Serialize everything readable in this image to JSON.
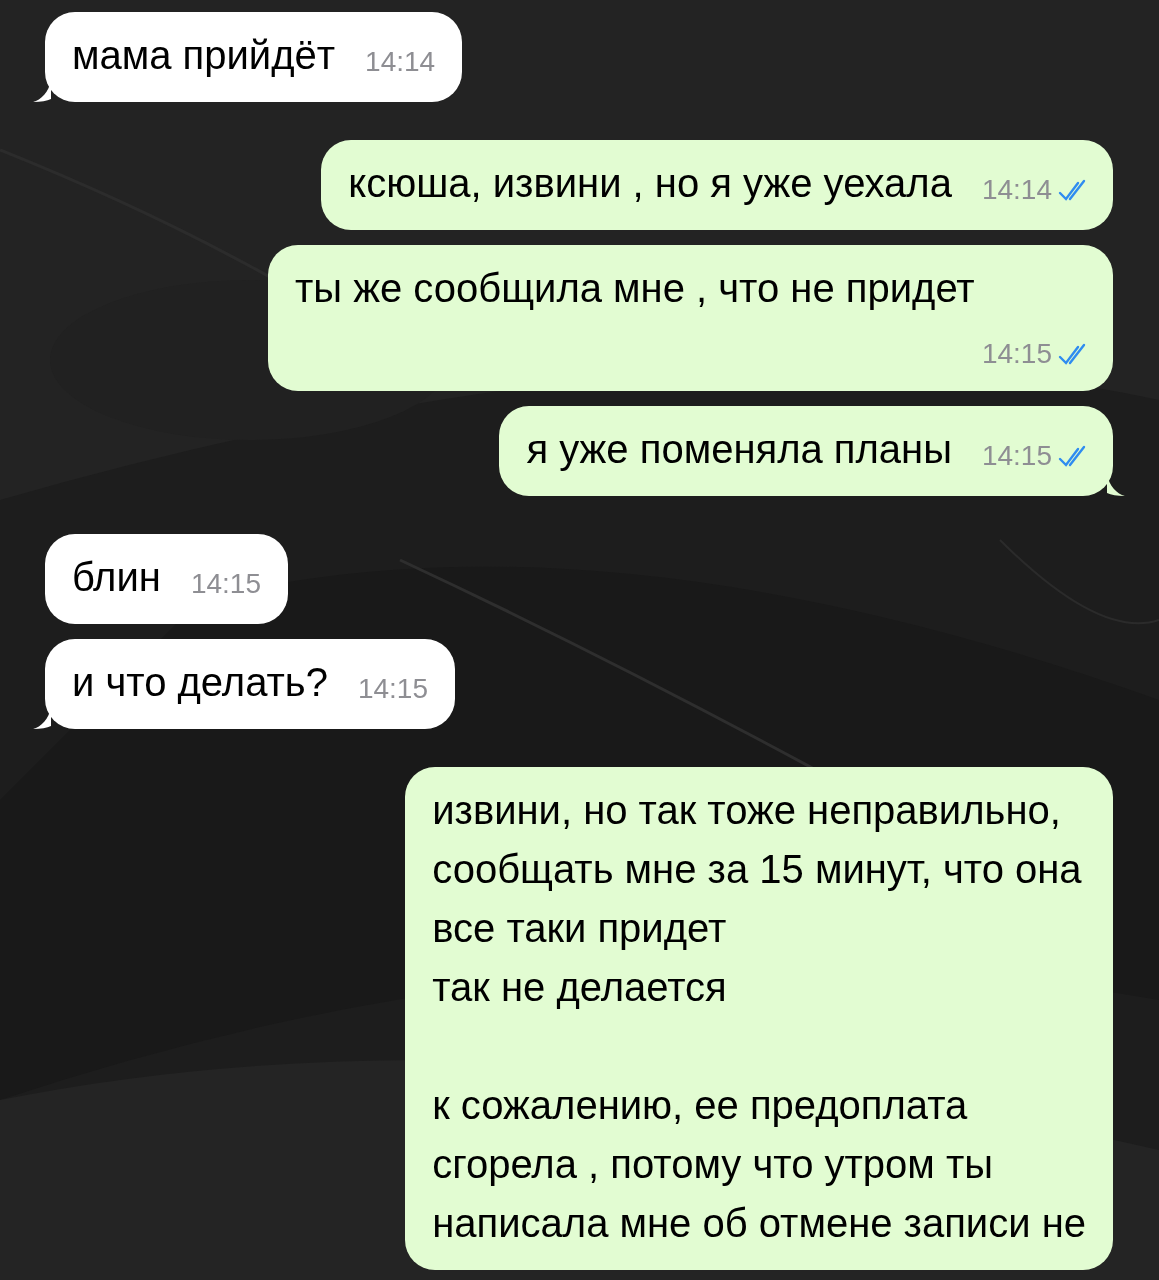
{
  "messages": [
    {
      "kind": "incoming",
      "text": "мама прийдёт",
      "time": "14:14",
      "tail": true
    },
    {
      "kind": "outgoing",
      "text": "ксюша, извини , но я уже уехала",
      "time": "14:14",
      "read": true,
      "tail": false
    },
    {
      "kind": "outgoing",
      "text": "ты же сообщила мне , что не придет",
      "time": "14:15",
      "read": true,
      "tail": false
    },
    {
      "kind": "outgoing",
      "text": "я уже поменяла планы",
      "time": "14:15",
      "read": true,
      "tail": true
    },
    {
      "kind": "incoming",
      "text": "блин",
      "time": "14:15",
      "tail": false
    },
    {
      "kind": "incoming",
      "text": "и что делать?",
      "time": "14:15",
      "tail": true
    },
    {
      "kind": "outgoing",
      "text": "извини, но так тоже неправильно,\nсообщать мне за 15 минут, что она\nвсе таки придет\nтак не делается\n\nк сожалению, ее предоплата\nсгорела , потому что утром ты\nнаписала мне об отмене записи не",
      "tail": false
    }
  ]
}
